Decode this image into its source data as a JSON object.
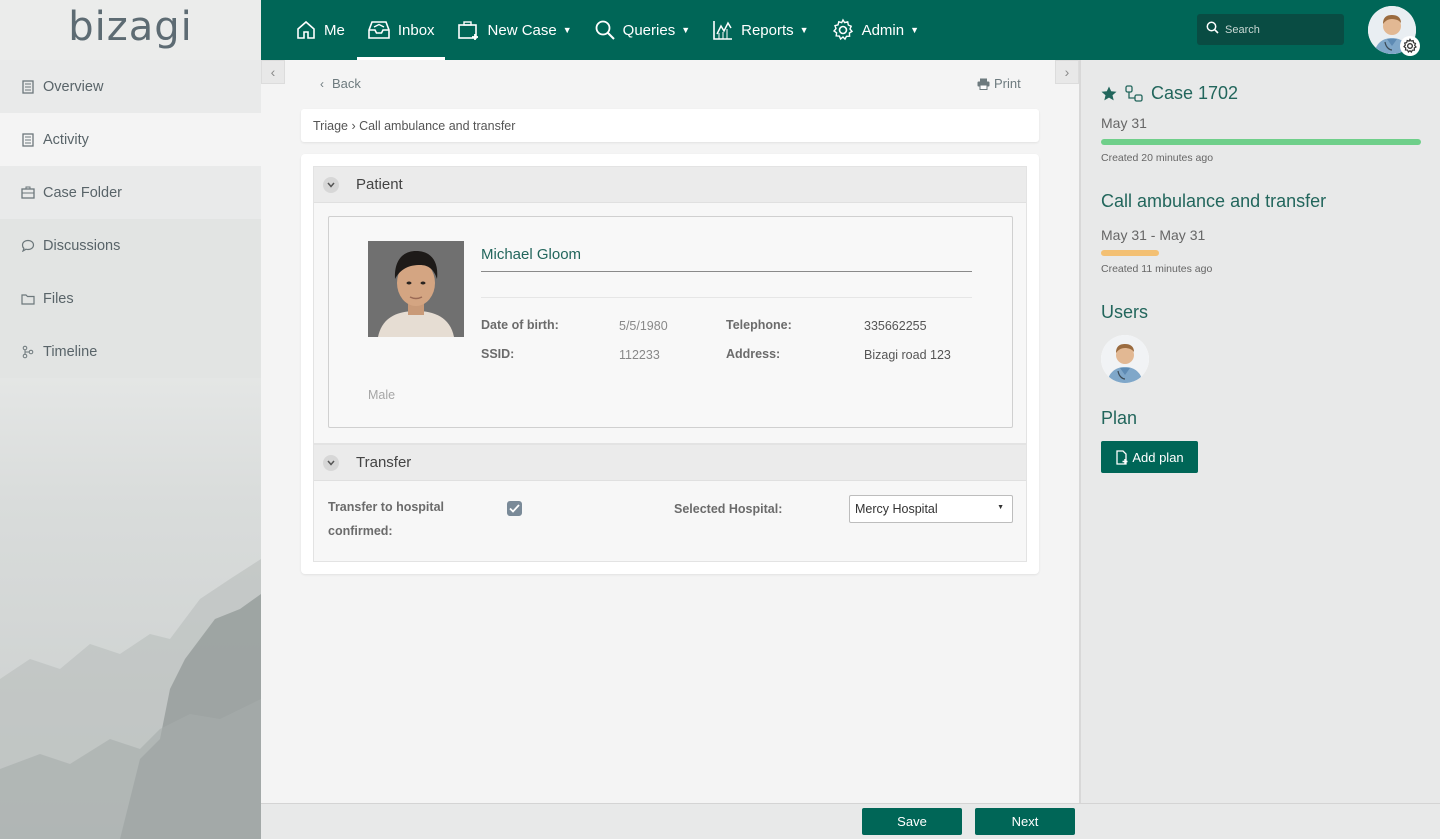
{
  "app": {
    "logo": "bizagi"
  },
  "sidebar": {
    "items": [
      {
        "label": "Overview",
        "icon": "document-icon"
      },
      {
        "label": "Activity",
        "icon": "document-icon"
      },
      {
        "label": "Case Folder",
        "icon": "briefcase-icon"
      },
      {
        "label": "Discussions",
        "icon": "chat-bubble-icon"
      },
      {
        "label": "Files",
        "icon": "folder-icon"
      },
      {
        "label": "Timeline",
        "icon": "timeline-icon"
      }
    ],
    "active_item": "Activity"
  },
  "topbar": {
    "menu": [
      {
        "label": "Me",
        "icon": "home-icon"
      },
      {
        "label": "Inbox",
        "icon": "inbox-icon"
      },
      {
        "label": "New Case",
        "icon": "new-case-icon"
      },
      {
        "label": "Queries",
        "icon": "search-icon"
      },
      {
        "label": "Reports",
        "icon": "chart-icon"
      },
      {
        "label": "Admin",
        "icon": "gear-icon"
      }
    ],
    "active_menu": "Inbox",
    "search_placeholder": "Search"
  },
  "main": {
    "back_label": "Back",
    "print_label": "Print",
    "breadcrumb": "Triage › Call ambulance and transfer",
    "patient_group": {
      "title": "Patient",
      "name": "Michael Gloom",
      "fields": {
        "dob_label": "Date of birth:",
        "dob_value": "5/5/1980",
        "telephone_label": "Telephone:",
        "telephone_value": "335662255",
        "ssid_label": "SSID:",
        "ssid_value": "112233",
        "address_label": "Address:",
        "address_value": "Bizagi road 123"
      },
      "gender": "Male"
    },
    "transfer_group": {
      "title": "Transfer",
      "confirmed_label_line1": "Transfer to hospital",
      "confirmed_label_line2": "confirmed:",
      "confirmed_checked": true,
      "hospital_label": "Selected Hospital:",
      "hospital_value": "Mercy Hospital"
    }
  },
  "footer": {
    "save_label": "Save",
    "next_label": "Next"
  },
  "right_panel": {
    "case_title": "Case 1702",
    "case_date": "May 31",
    "case_created": "Created 20 minutes ago",
    "case_progress": 1.0,
    "task_title": "Call ambulance and transfer",
    "task_dates": "May 31 - May 31",
    "task_created": "Created 11 minutes ago",
    "task_progress": 0.18,
    "users_heading": "Users",
    "plan_heading": "Plan",
    "add_plan_label": "Add plan"
  },
  "colors": {
    "brand": "#006657",
    "accent_text": "#22665c",
    "progress_green": "#6fcf8a",
    "progress_orange": "#f3c073"
  }
}
